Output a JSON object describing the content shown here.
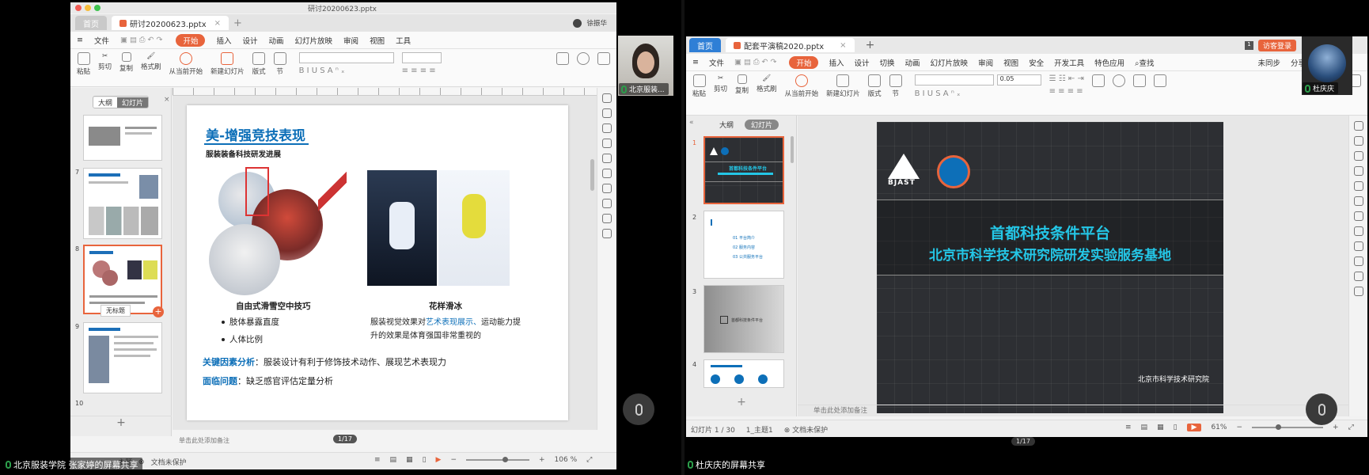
{
  "left": {
    "window_title": "研讨20200623.pptx",
    "tabs": [
      {
        "label": "首页"
      },
      {
        "label": "研讨20200623.pptx"
      }
    ],
    "user_name": "徐振华",
    "menu": [
      "文件",
      "开始",
      "插入",
      "设计",
      "动画",
      "幻灯片放映",
      "审阅",
      "视图",
      "工具"
    ],
    "ribbon": [
      "粘贴",
      "剪切",
      "复制",
      "格式刷",
      "从当前开始",
      "新建幻灯片",
      "版式",
      "节"
    ],
    "panel_tabs": [
      "大纲",
      "幻灯片"
    ],
    "thumb_numbers": [
      "7",
      "8",
      "9",
      "10"
    ],
    "drag_hint": "无标题",
    "slide": {
      "title": "美-增强竞技表现",
      "subtitle": "服装装备科技研发进展",
      "left_heading": "自由式滑雪空中技巧",
      "left_bullets": [
        "肢体暴露直度",
        "人体比例"
      ],
      "right_heading": "花样滑冰",
      "right_bullet_pre": "服装视觉效果对",
      "right_bullet_em": "艺术表现展示、",
      "right_bullet_post": "运动能力提升的效果是体育强国非常重视的",
      "key_label": "关键因素分析",
      "key_text": "：服装设计有利于修饰技术动作、展现艺术表现力",
      "issue_label": "面临问题",
      "issue_text": "：缺乏感官评估定量分析"
    },
    "notes_placeholder": "单击此处添加备注",
    "page_indicator": "1/17",
    "zoom": "106 %",
    "status_items": [
      "主题",
      "文档未保护"
    ],
    "bottom_label": "北京服装学院 张家婷的屏幕共享",
    "cam_label": "北京服装..."
  },
  "right": {
    "tabs": [
      {
        "label": "首页"
      },
      {
        "label": "配套平演稿2020.pptx"
      }
    ],
    "login_button": "访客登录",
    "menu": [
      "文件",
      "开始",
      "插入",
      "设计",
      "切换",
      "动画",
      "幻灯片放映",
      "审阅",
      "视图",
      "安全",
      "开发工具",
      "特色应用",
      "查找"
    ],
    "menu_right": [
      "未同步",
      "分享"
    ],
    "ribbon": [
      "粘贴",
      "剪切",
      "复制",
      "格式刷",
      "从当前开始",
      "新建幻灯片",
      "版式",
      "节"
    ],
    "font_size": "0.05",
    "panel_tabs": [
      "大纲",
      "幻灯片"
    ],
    "thumb_numbers": [
      "1",
      "2",
      "3",
      "4"
    ],
    "thumb1_title": "首都科技条件平台",
    "thumb2_items": [
      "01 平台简介",
      "02 服务内容",
      "03 公共服务平台"
    ],
    "thumb3_text": "首都科技条件平台",
    "slide": {
      "logo_text": "BJAST",
      "title1": "首都科技条件平台",
      "title2": "北京市科学技术研究院研发实验服务基地",
      "footer": "北京市科学技术研究院"
    },
    "notes_placeholder": "单击此处添加备注",
    "status_slide": "幻灯片 1 / 30",
    "status_theme": "1_主题1",
    "status_protect": "文档未保护",
    "zoom": "61%",
    "page_indicator": "1/17",
    "bottom_label": "杜庆庆的屏幕共享",
    "cam_label": "杜庆庆"
  },
  "colors": {
    "accent": "#e8643c",
    "slide_blue": "#0d6fb8",
    "cyan": "#24c6e6"
  }
}
